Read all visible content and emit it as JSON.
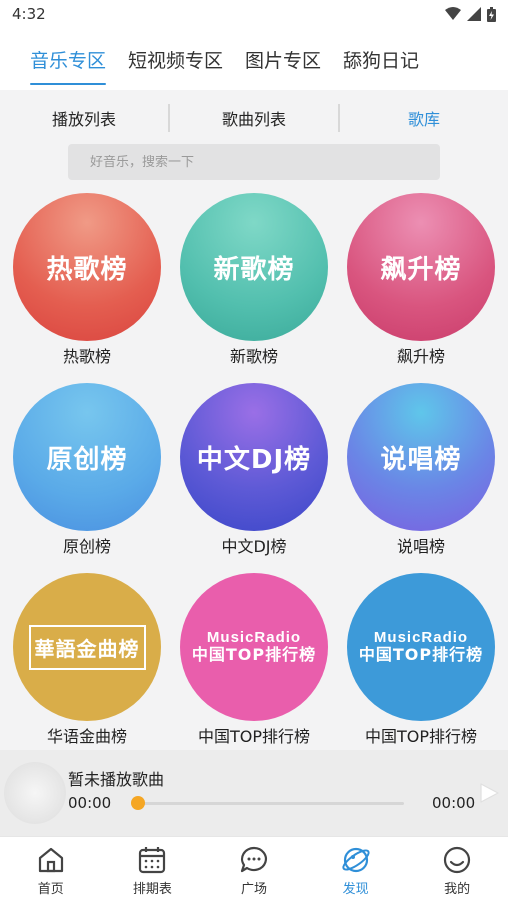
{
  "status_bar": {
    "time": "4:32"
  },
  "top_tabs": [
    {
      "label": "音乐专区",
      "active": true
    },
    {
      "label": "短视频专区",
      "active": false
    },
    {
      "label": "图片专区",
      "active": false
    },
    {
      "label": "舔狗日记",
      "active": false
    }
  ],
  "sub_tabs": [
    {
      "label": "播放列表",
      "active": false
    },
    {
      "label": "歌曲列表",
      "active": false
    },
    {
      "label": "歌库",
      "active": true
    }
  ],
  "search": {
    "placeholder": "好音乐，搜索一下"
  },
  "charts": [
    {
      "cover_text": "热歌榜",
      "label": "热歌榜"
    },
    {
      "cover_text": "新歌榜",
      "label": "新歌榜"
    },
    {
      "cover_text": "飙升榜",
      "label": "飙升榜"
    },
    {
      "cover_text": "原创榜",
      "label": "原创榜"
    },
    {
      "cover_text": "中文DJ榜",
      "label": "中文DJ榜"
    },
    {
      "cover_text": "说唱榜",
      "label": "说唱榜"
    },
    {
      "cover_text": "華語金曲榜",
      "label": "华语金曲榜"
    },
    {
      "cover_text_line1": "MusicRadio",
      "cover_text_line2": "中国TOP排行榜",
      "label": "中国TOP排行榜"
    },
    {
      "cover_text_line1": "MusicRadio",
      "cover_text_line2": "中国TOP排行榜",
      "label": "中国TOP排行榜"
    }
  ],
  "player": {
    "title": "暂未播放歌曲",
    "current_time": "00:00",
    "total_time": "00:00",
    "progress": 0
  },
  "bottom_nav": [
    {
      "label": "首页",
      "icon": "home-icon",
      "active": false
    },
    {
      "label": "排期表",
      "icon": "calendar-icon",
      "active": false
    },
    {
      "label": "广场",
      "icon": "chat-icon",
      "active": false
    },
    {
      "label": "发现",
      "icon": "planet-icon",
      "active": true
    },
    {
      "label": "我的",
      "icon": "smile-icon",
      "active": false
    }
  ],
  "colors": {
    "accent": "#2f8fd8",
    "progress_knob": "#f5a623"
  }
}
